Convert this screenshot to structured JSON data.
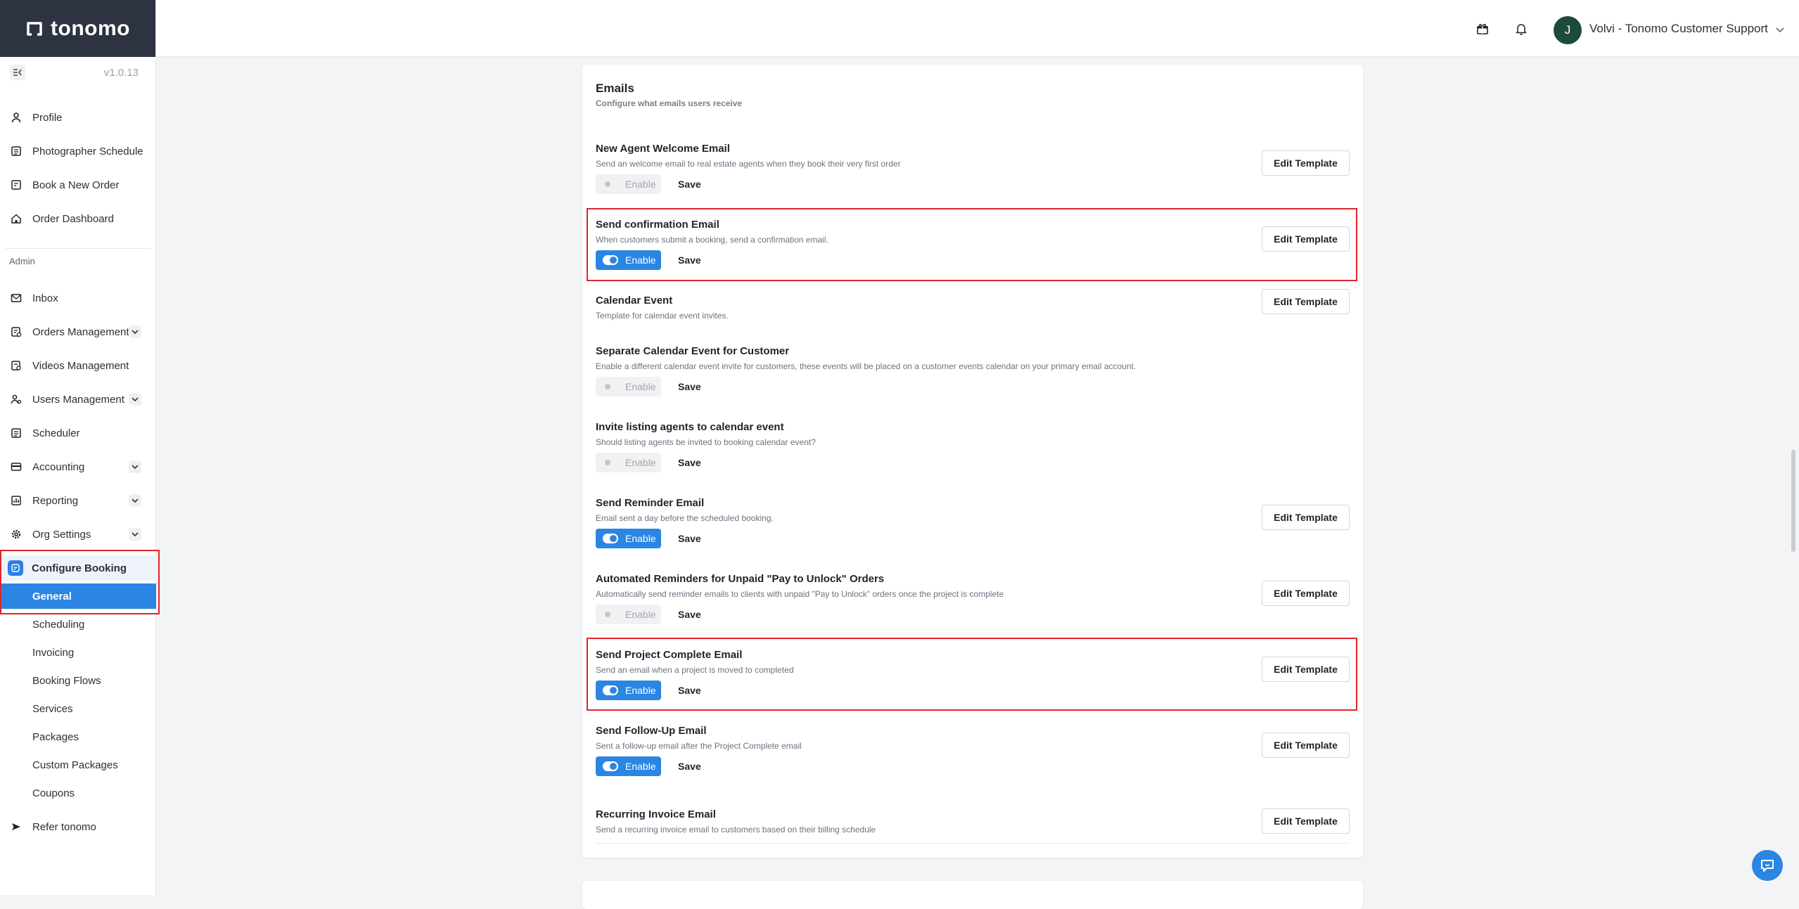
{
  "app": {
    "logo_text": "tonomo",
    "version": "v1.0.13"
  },
  "header": {
    "avatar_initial": "J",
    "user_name": "Volvi - Tonomo Customer Support"
  },
  "sidebar": {
    "items": [
      {
        "label": "Profile",
        "icon": "user-icon"
      },
      {
        "label": "Photographer Schedule",
        "icon": "calendar-icon"
      },
      {
        "label": "Book a New Order",
        "icon": "document-icon"
      },
      {
        "label": "Order Dashboard",
        "icon": "home-icon"
      }
    ],
    "admin_label": "Admin",
    "admin_items": [
      {
        "label": "Inbox",
        "icon": "mail-icon",
        "expandable": false
      },
      {
        "label": "Orders Management",
        "icon": "orders-icon",
        "expandable": true
      },
      {
        "label": "Videos Management",
        "icon": "video-icon",
        "expandable": false
      },
      {
        "label": "Users Management",
        "icon": "users-icon",
        "expandable": true
      },
      {
        "label": "Scheduler",
        "icon": "scheduler-icon",
        "expandable": false
      },
      {
        "label": "Accounting",
        "icon": "accounting-icon",
        "expandable": true
      },
      {
        "label": "Reporting",
        "icon": "reporting-icon",
        "expandable": true
      },
      {
        "label": "Org Settings",
        "icon": "gear-icon",
        "expandable": true
      }
    ],
    "configure_label": "Configure Booking",
    "sub_items": [
      {
        "label": "General",
        "active": true
      },
      {
        "label": "Scheduling"
      },
      {
        "label": "Invoicing"
      },
      {
        "label": "Booking Flows"
      },
      {
        "label": "Services"
      },
      {
        "label": "Packages"
      },
      {
        "label": "Custom Packages"
      },
      {
        "label": "Coupons"
      }
    ],
    "refer_label": "Refer tonomo"
  },
  "emails": {
    "title": "Emails",
    "subtitle": "Configure what emails users receive",
    "enable_label": "Enable",
    "save_label": "Save",
    "edit_label": "Edit Template",
    "rows": [
      {
        "title": "New Agent Welcome Email",
        "desc": "Send an welcome email to real estate agents when they book their very first order",
        "toggle": "off",
        "edit": true
      },
      {
        "title": "Send confirmation Email",
        "desc": "When customers submit a booking, send a confirmation email.",
        "toggle": "on",
        "edit": true
      },
      {
        "title": "Calendar Event",
        "desc": "Template for calendar event invites.",
        "toggle": null,
        "edit": true
      },
      {
        "title": "Separate Calendar Event for Customer",
        "desc": "Enable a different calendar event invite for customers, these events will be placed on a customer events calendar on your primary email account.",
        "toggle": "off",
        "edit": false
      },
      {
        "title": "Invite listing agents to calendar event",
        "desc": "Should listing agents be invited to booking calendar event?",
        "toggle": "off",
        "edit": false
      },
      {
        "title": "Send Reminder Email",
        "desc": "Email sent a day before the scheduled booking.",
        "toggle": "on",
        "edit": true
      },
      {
        "title": "Automated Reminders for Unpaid \"Pay to Unlock\" Orders",
        "desc": "Automatically send reminder emails to clients with unpaid \"Pay to Unlock\" orders once the project is complete",
        "toggle": "off",
        "edit": true
      },
      {
        "title": "Send Project Complete Email",
        "desc": "Send an email when a project is moved to completed",
        "toggle": "on",
        "edit": true
      },
      {
        "title": "Send Follow-Up Email",
        "desc": "Sent a follow-up email after the Project Complete email",
        "toggle": "on",
        "edit": true
      },
      {
        "title": "Recurring Invoice Email",
        "desc": "Send a recurring invoice email to customers based on their billing schedule",
        "toggle": null,
        "edit": true
      }
    ]
  },
  "colors": {
    "accent": "#2b86e3",
    "sidebar_dark": "#2d3340",
    "highlight": "#e0252c"
  }
}
